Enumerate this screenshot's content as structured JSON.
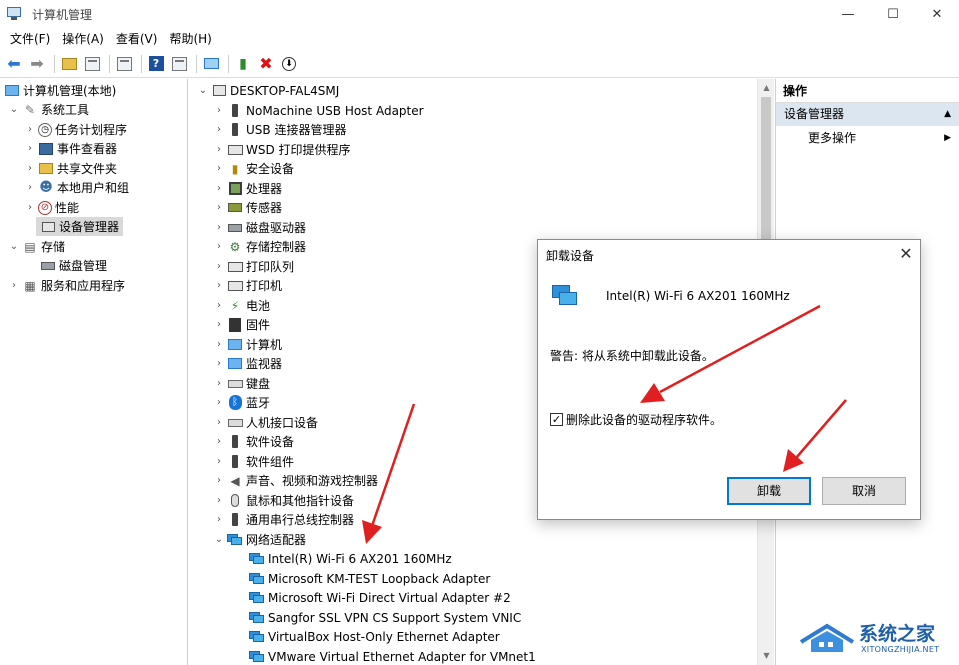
{
  "window": {
    "title": "计算机管理",
    "minimize": "—",
    "maximize": "☐",
    "close": "✕"
  },
  "menu": [
    "文件(F)",
    "操作(A)",
    "查看(V)",
    "帮助(H)"
  ],
  "left_tree": {
    "root": "计算机管理(本地)",
    "system_tools": "系统工具",
    "task_scheduler": "任务计划程序",
    "event_viewer": "事件查看器",
    "shared_folders": "共享文件夹",
    "local_users": "本地用户和组",
    "performance": "性能",
    "device_manager": "设备管理器",
    "storage": "存储",
    "disk_management": "磁盘管理",
    "services": "服务和应用程序"
  },
  "devices": {
    "computer": "DESKTOP-FAL4SMJ",
    "categories": [
      "NoMachine USB Host Adapter",
      "USB 连接器管理器",
      "WSD 打印提供程序",
      "安全设备",
      "处理器",
      "传感器",
      "磁盘驱动器",
      "存储控制器",
      "打印队列",
      "打印机",
      "电池",
      "固件",
      "计算机",
      "监视器",
      "键盘",
      "蓝牙",
      "人机接口设备",
      "软件设备",
      "软件组件",
      "声音、视频和游戏控制器",
      "鼠标和其他指针设备",
      "通用串行总线控制器"
    ],
    "network_category": "网络适配器",
    "network_adapters": [
      "Intel(R) Wi-Fi 6 AX201 160MHz",
      "Microsoft KM-TEST Loopback Adapter",
      "Microsoft Wi-Fi Direct Virtual Adapter #2",
      "Sangfor SSL VPN CS Support System VNIC",
      "VirtualBox Host-Only Ethernet Adapter",
      "VMware Virtual Ethernet Adapter for VMnet1"
    ]
  },
  "actions": {
    "header": "操作",
    "section": "设备管理器",
    "more": "更多操作"
  },
  "dialog": {
    "title": "卸载设备",
    "device_name": "Intel(R) Wi-Fi 6 AX201 160MHz",
    "warning": "警告: 将从系统中卸载此设备。",
    "checkbox_label": "删除此设备的驱动程序软件。",
    "checkbox_checked": true,
    "uninstall": "卸载",
    "cancel": "取消",
    "close": "✕"
  },
  "watermark": {
    "text": "系统之家",
    "sub": "XITONGZHIJIA.NET"
  },
  "colors": {
    "arrow": "#e02020",
    "accent": "#0078d7",
    "selection": "#d9d9d9",
    "actions_section": "#dce6f0"
  }
}
